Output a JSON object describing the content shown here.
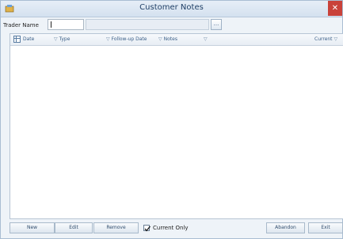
{
  "window": {
    "title": "Customer Notes",
    "close_label": "✕"
  },
  "filter": {
    "trader_name_label": "Trader Name",
    "trader_code_value": "",
    "trader_name_value": "",
    "lookup_label": "..."
  },
  "grid": {
    "columns": [
      {
        "label": "Date"
      },
      {
        "label": "Type"
      },
      {
        "label": "Follow-up Date"
      },
      {
        "label": "Notes"
      },
      {
        "label": "Current"
      }
    ],
    "rows": []
  },
  "footer": {
    "new_label": "New",
    "edit_label": "Edit",
    "remove_label": "Remove",
    "current_only_label": "Current Only",
    "current_only_checked": true,
    "abandon_label": "Abandon",
    "exit_label": "Exit"
  },
  "colors": {
    "title_bar": "#d4e1ef",
    "close_button": "#c9423a",
    "header_text": "#3b5f87"
  }
}
